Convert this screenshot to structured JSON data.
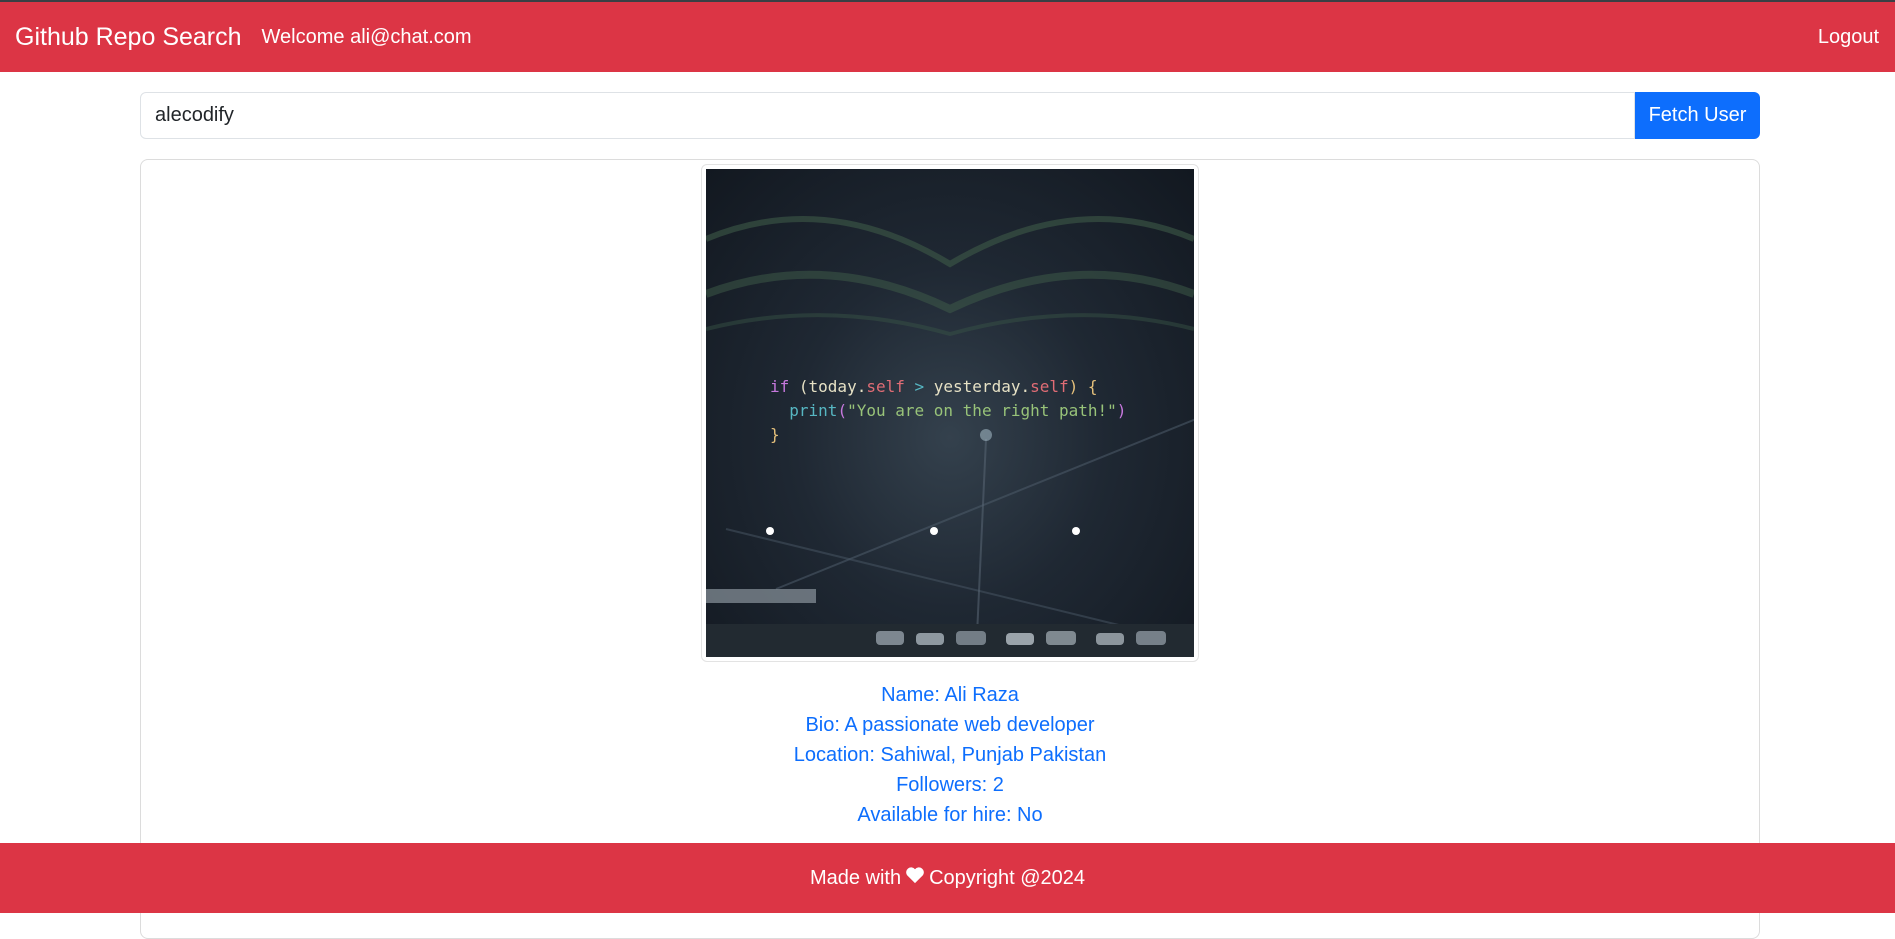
{
  "navbar": {
    "brand": "Github Repo Search",
    "welcome": "Welcome ali@chat.com",
    "logout": "Logout"
  },
  "search": {
    "value": "alecodify",
    "button": "Fetch User"
  },
  "avatar": {
    "code_lines": [
      [
        "if",
        " (today.",
        "self",
        " > ",
        "yesterday.",
        "self",
        ") {"
      ],
      [
        "print",
        "(",
        "\"You are on the right path!\"",
        ")"
      ],
      [
        "}"
      ]
    ]
  },
  "profile": {
    "name": "Name: Ali Raza",
    "bio": "Bio: A passionate web developer",
    "location": "Location: Sahiwal, Punjab Pakistan",
    "followers": "Followers: 2",
    "hireable": "Available for hire: No"
  },
  "footer": {
    "made_with": "Made with",
    "heart_icon": "heart-icon",
    "copyright": "Copyright @2024"
  },
  "colors": {
    "brand": "#dc3545",
    "primary": "#0d6efd"
  }
}
